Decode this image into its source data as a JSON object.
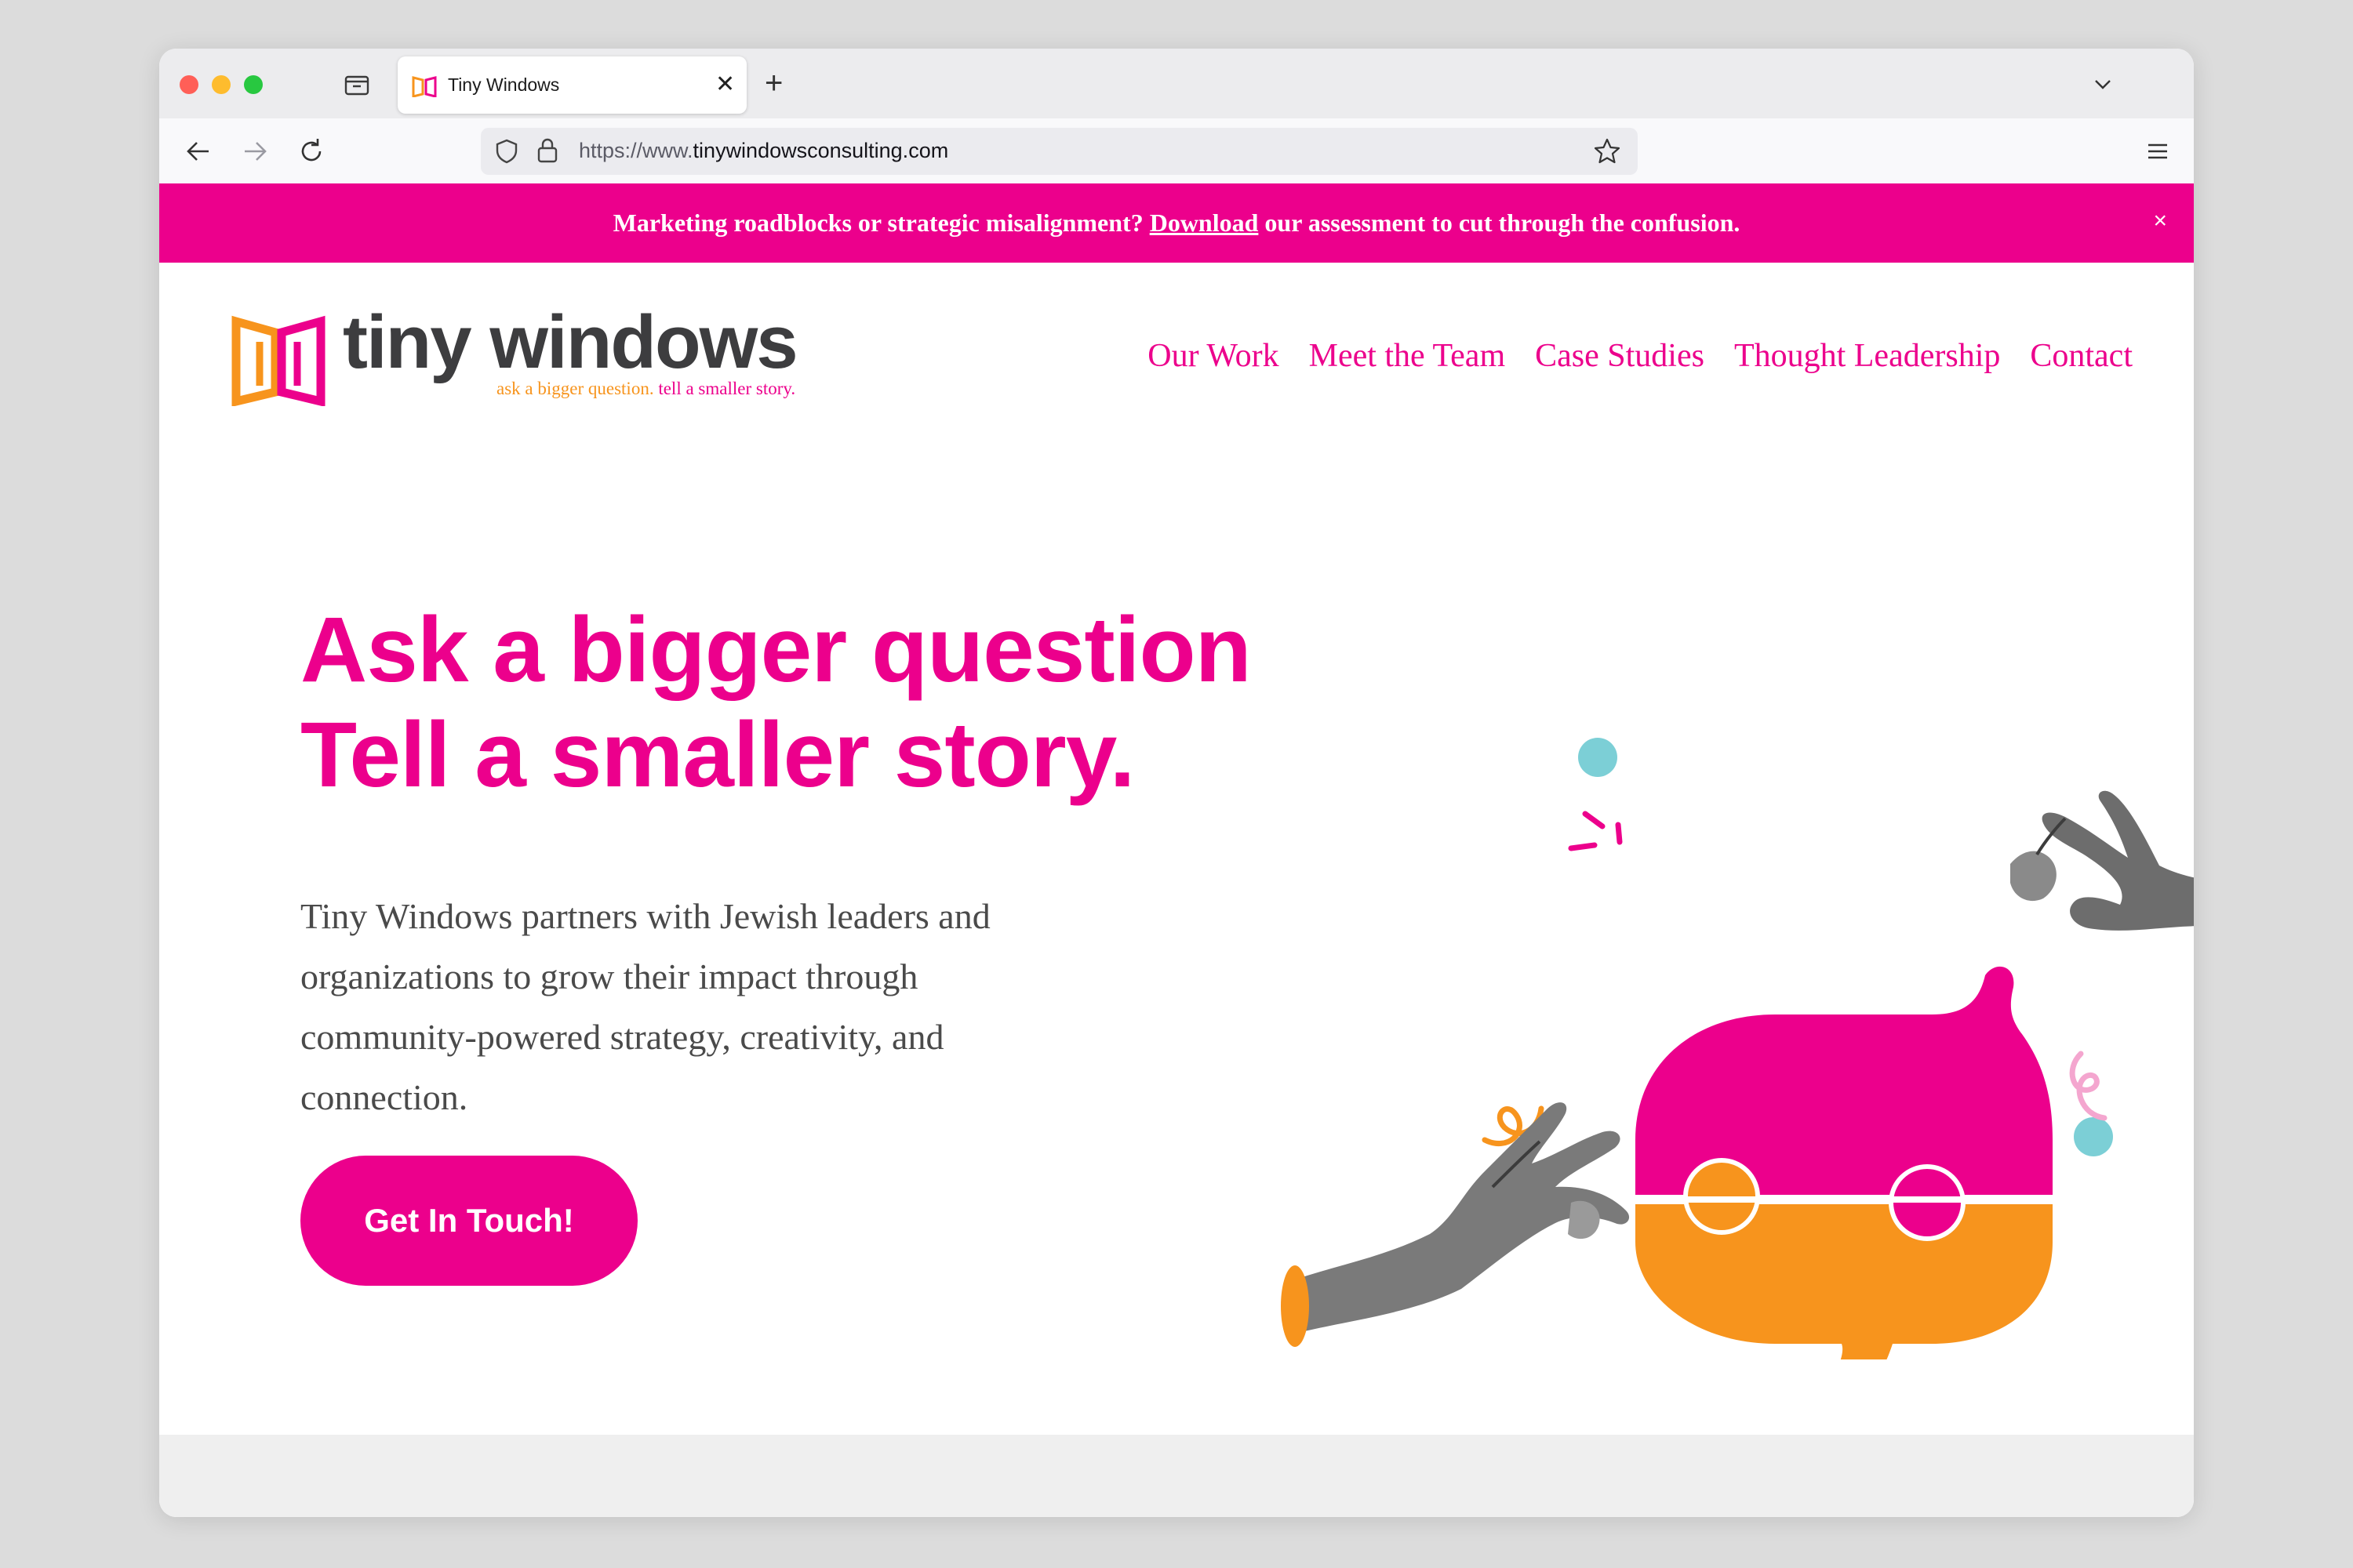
{
  "browser": {
    "tab_title": "Tiny Windows",
    "url_prefix": "https://www.",
    "url_domain": "tinywindowsconsulting.com"
  },
  "banner": {
    "text_before": "Marketing roadblocks or strategic misalignment? ",
    "link": "Download",
    "text_after": " our assessment to cut through the confusion.",
    "close": "×"
  },
  "logo": {
    "wordmark": "tiny windows",
    "tagline_1": "ask a bigger question.",
    "tagline_2": "tell a smaller story."
  },
  "nav": {
    "items": [
      "Our Work",
      "Meet the Team",
      "Case Studies",
      "Thought Leadership",
      "Contact"
    ]
  },
  "hero": {
    "title_line1": "Ask a bigger question",
    "title_line2": "Tell a smaller story.",
    "body": "Tiny Windows partners with Jewish leaders and organizations to grow their impact through community-powered strategy, creativity, and connection.",
    "cta": "Get In Touch!"
  },
  "colors": {
    "brand_pink": "#ec008c",
    "brand_orange": "#f7941d",
    "accent_teal": "#7ccfd6",
    "text_dark": "#3d3d3f"
  },
  "icons": [
    "overview-icon",
    "back-icon",
    "forward-icon",
    "reload-icon",
    "shield-icon",
    "lock-icon",
    "bookmark-star-icon",
    "menu-icon",
    "chevron-down-icon",
    "close-icon",
    "plus-icon"
  ]
}
